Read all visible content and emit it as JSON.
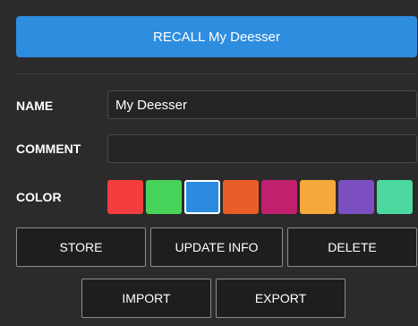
{
  "recall_button": {
    "label": "RECALL My Deesser",
    "color": "#2f8de0"
  },
  "form": {
    "name_label": "NAME",
    "name_value": "My Deesser",
    "comment_label": "COMMENT",
    "comment_value": "",
    "color_label": "COLOR"
  },
  "colors": {
    "swatches": [
      {
        "name": "red",
        "hex": "#f43d3d"
      },
      {
        "name": "green",
        "hex": "#48d45a"
      },
      {
        "name": "blue",
        "hex": "#2b8be0",
        "selected": true
      },
      {
        "name": "orange",
        "hex": "#ea5d28"
      },
      {
        "name": "magenta",
        "hex": "#c0206e"
      },
      {
        "name": "amber",
        "hex": "#f5a93a"
      },
      {
        "name": "purple",
        "hex": "#7b4fc0"
      },
      {
        "name": "mint",
        "hex": "#4cd9a0"
      }
    ]
  },
  "actions": {
    "store": "STORE",
    "update_info": "UPDATE INFO",
    "delete": "DELETE",
    "import": "IMPORT",
    "export": "EXPORT"
  }
}
